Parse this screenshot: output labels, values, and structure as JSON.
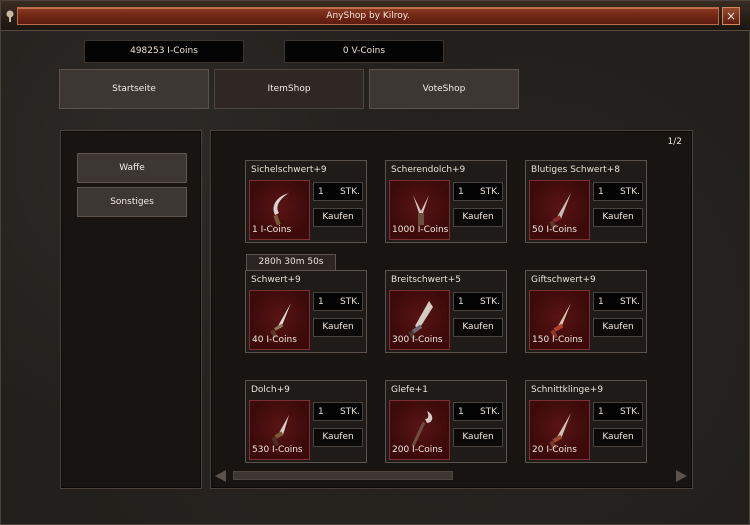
{
  "window": {
    "title": "AnyShop by Kilroy.",
    "close_label": "×"
  },
  "balances": {
    "i_coins": "498253 I-Coins",
    "v_coins": "0 V-Coins"
  },
  "nav": {
    "home": "Startseite",
    "itemshop": "ItemShop",
    "voteshop": "VoteShop",
    "active": "ItemShop"
  },
  "categories": [
    {
      "label": "Waffe"
    },
    {
      "label": "Sonstiges"
    }
  ],
  "pagination": {
    "page": "1/2"
  },
  "timer": "280h 30m 50s",
  "colors": {
    "title_bar": "#6e2514",
    "item_image_bg": "#5a1414",
    "panel_bg": "#171412"
  },
  "items": [
    {
      "name": "Sichelschwert+9",
      "price": "1 I-Coins",
      "qty": "1",
      "unit": "STK.",
      "buy": "Kaufen",
      "icon": "sickle-sword-icon"
    },
    {
      "name": "Scherendolch+9",
      "price": "1000 I-Coins",
      "qty": "1",
      "unit": "STK.",
      "buy": "Kaufen",
      "icon": "scissor-dagger-icon"
    },
    {
      "name": "Blutiges Schwert+8",
      "price": "50 I-Coins",
      "qty": "1",
      "unit": "STK.",
      "buy": "Kaufen",
      "icon": "bloody-sword-icon"
    },
    {
      "name": "Schwert+9",
      "price": "40 I-Coins",
      "qty": "1",
      "unit": "STK.",
      "buy": "Kaufen",
      "icon": "sword-icon"
    },
    {
      "name": "Breitschwert+5",
      "price": "300 I-Coins",
      "qty": "1",
      "unit": "STK.",
      "buy": "Kaufen",
      "icon": "broadsword-icon"
    },
    {
      "name": "Giftschwert+9",
      "price": "150 I-Coins",
      "qty": "1",
      "unit": "STK.",
      "buy": "Kaufen",
      "icon": "poison-sword-icon"
    },
    {
      "name": "Dolch+9",
      "price": "530 I-Coins",
      "qty": "1",
      "unit": "STK.",
      "buy": "Kaufen",
      "icon": "dagger-icon"
    },
    {
      "name": "Glefe+1",
      "price": "200 I-Coins",
      "qty": "1",
      "unit": "STK.",
      "buy": "Kaufen",
      "icon": "glaive-icon"
    },
    {
      "name": "Schnittklinge+9",
      "price": "20 I-Coins",
      "qty": "1",
      "unit": "STK.",
      "buy": "Kaufen",
      "icon": "cutting-blade-icon"
    }
  ]
}
